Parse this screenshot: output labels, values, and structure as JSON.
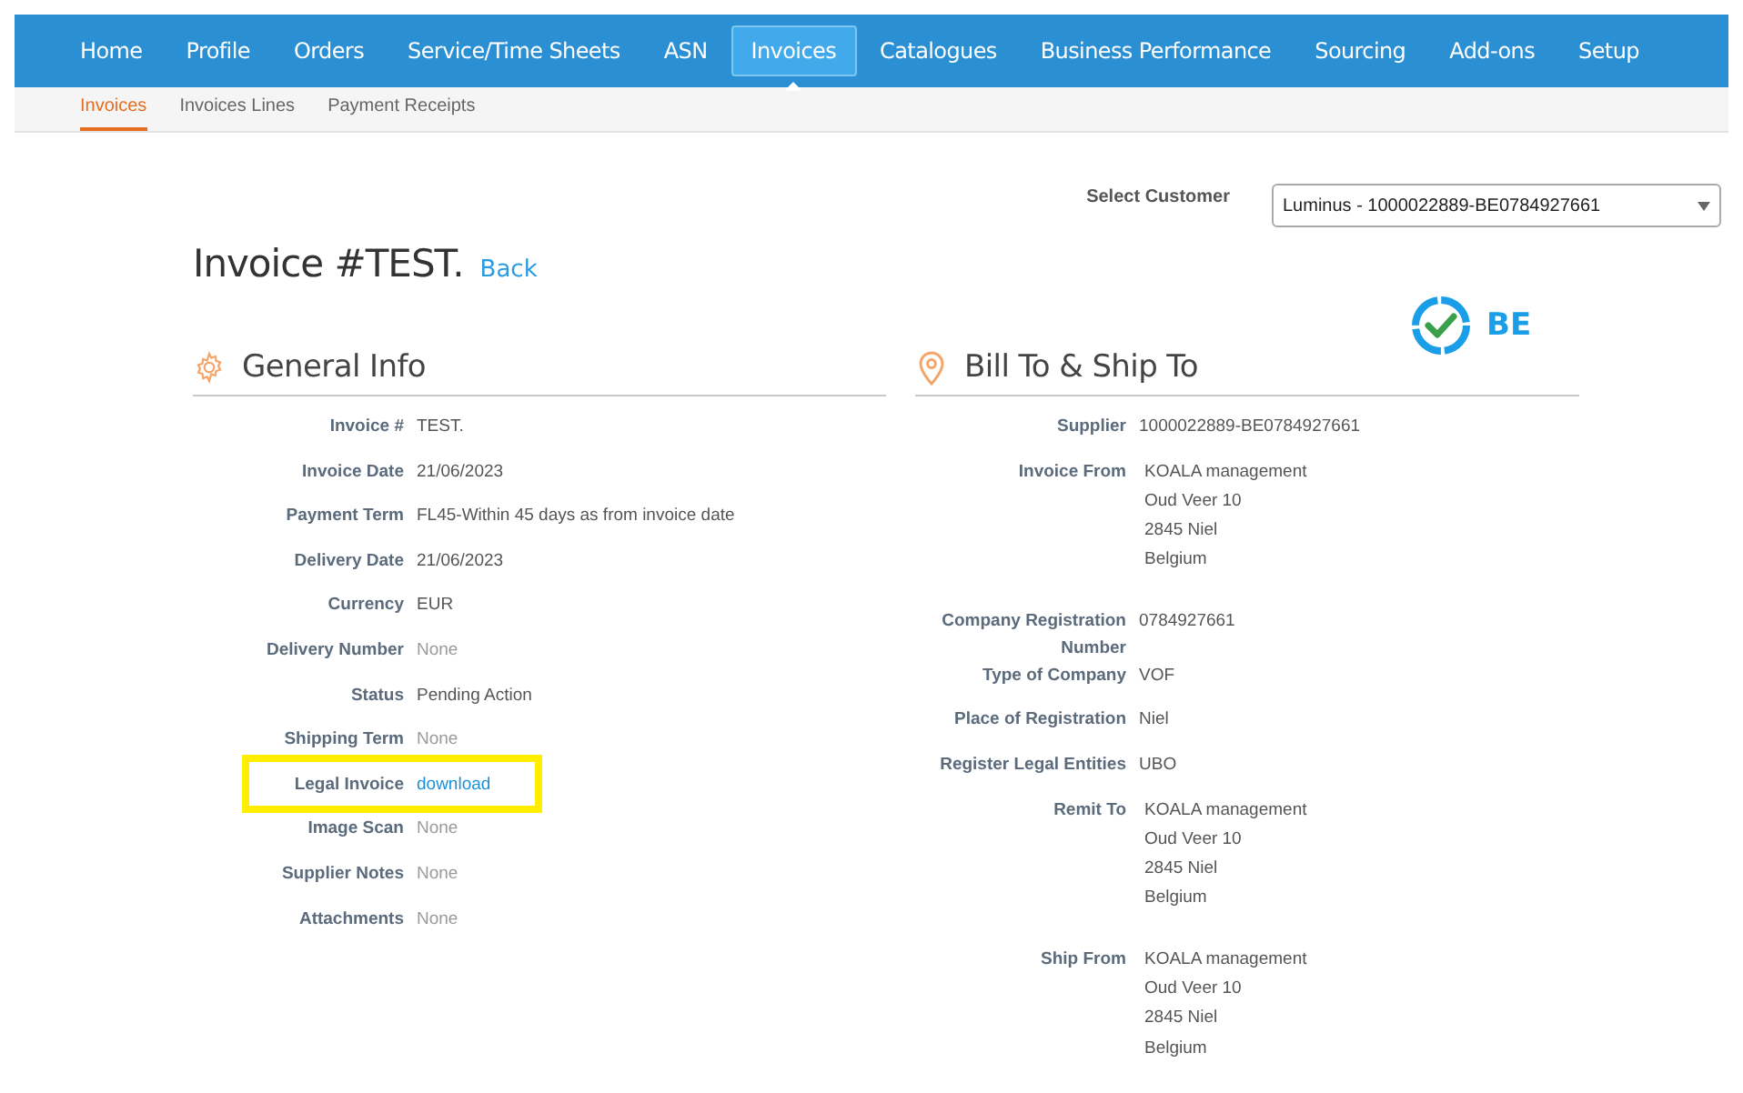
{
  "nav": [
    {
      "label": "Home",
      "selected": false
    },
    {
      "label": "Profile",
      "selected": false
    },
    {
      "label": "Orders",
      "selected": false
    },
    {
      "label": "Service/Time Sheets",
      "selected": false
    },
    {
      "label": "ASN",
      "selected": false
    },
    {
      "label": "Invoices",
      "selected": true
    },
    {
      "label": "Catalogues",
      "selected": false
    },
    {
      "label": "Business Performance",
      "selected": false
    },
    {
      "label": "Sourcing",
      "selected": false
    },
    {
      "label": "Add-ons",
      "selected": false
    },
    {
      "label": "Setup",
      "selected": false
    }
  ],
  "subnav": [
    {
      "label": "Invoices",
      "selected": true
    },
    {
      "label": "Invoices Lines",
      "selected": false
    },
    {
      "label": "Payment Receipts",
      "selected": false
    }
  ],
  "customer_select": {
    "label": "Select Customer",
    "value": "Luminus - 1000022889-BE0784927661"
  },
  "title": "Invoice #TEST.",
  "back_link": "Back",
  "country_badge": "BE",
  "general_info": {
    "heading": "General Info",
    "fields": [
      {
        "label": "Invoice #",
        "kind": "plain",
        "value": "TEST.",
        "highlighted": false
      },
      {
        "label": "Invoice Date",
        "kind": "plain",
        "value": "21/06/2023",
        "highlighted": false
      },
      {
        "label": "Payment Term",
        "kind": "plain",
        "value": "FL45-Within 45 days as from invoice date",
        "highlighted": false
      },
      {
        "label": "Delivery Date",
        "kind": "plain",
        "value": "21/06/2023",
        "highlighted": false
      },
      {
        "label": "Currency",
        "kind": "plain",
        "value": "EUR",
        "highlighted": false
      },
      {
        "label": "Delivery Number",
        "kind": "muted",
        "value": "None",
        "highlighted": false
      },
      {
        "label": "Status",
        "kind": "plain",
        "value": "Pending Action",
        "highlighted": false
      },
      {
        "label": "Shipping Term",
        "kind": "muted",
        "value": "None",
        "highlighted": false
      },
      {
        "label": "Legal Invoice",
        "kind": "link",
        "value": "download",
        "highlighted": true
      },
      {
        "label": "Image Scan",
        "kind": "muted",
        "value": "None",
        "highlighted": false
      },
      {
        "label": "Supplier Notes",
        "kind": "muted",
        "value": "None",
        "highlighted": false
      },
      {
        "label": "Attachments",
        "kind": "muted",
        "value": "None",
        "highlighted": false
      }
    ]
  },
  "bill_ship": {
    "heading": "Bill To & Ship To",
    "fields": [
      {
        "label": "Supplier",
        "kind": "plain",
        "value": "1000022889-BE0784927661"
      },
      {
        "label": "Invoice From",
        "kind": "address",
        "lines": [
          "KOALA management",
          "Oud Veer 10",
          "2845 Niel",
          "Belgium"
        ]
      },
      {
        "label": "Company Registration Number",
        "kind": "plain",
        "value": "0784927661"
      },
      {
        "label": "Type of Company",
        "kind": "plain",
        "value": "VOF"
      },
      {
        "label": "Place of Registration",
        "kind": "plain",
        "value": "Niel"
      },
      {
        "label": "Register Legal Entities",
        "kind": "plain",
        "value": "UBO"
      },
      {
        "label": "Remit To",
        "kind": "address",
        "lines": [
          "KOALA management",
          "Oud Veer 10",
          "2845 Niel",
          "Belgium"
        ]
      },
      {
        "label": "Ship From",
        "kind": "address",
        "lines": [
          "KOALA management",
          "Oud Veer 10",
          "2845 Niel",
          "Belgium"
        ]
      }
    ]
  }
}
